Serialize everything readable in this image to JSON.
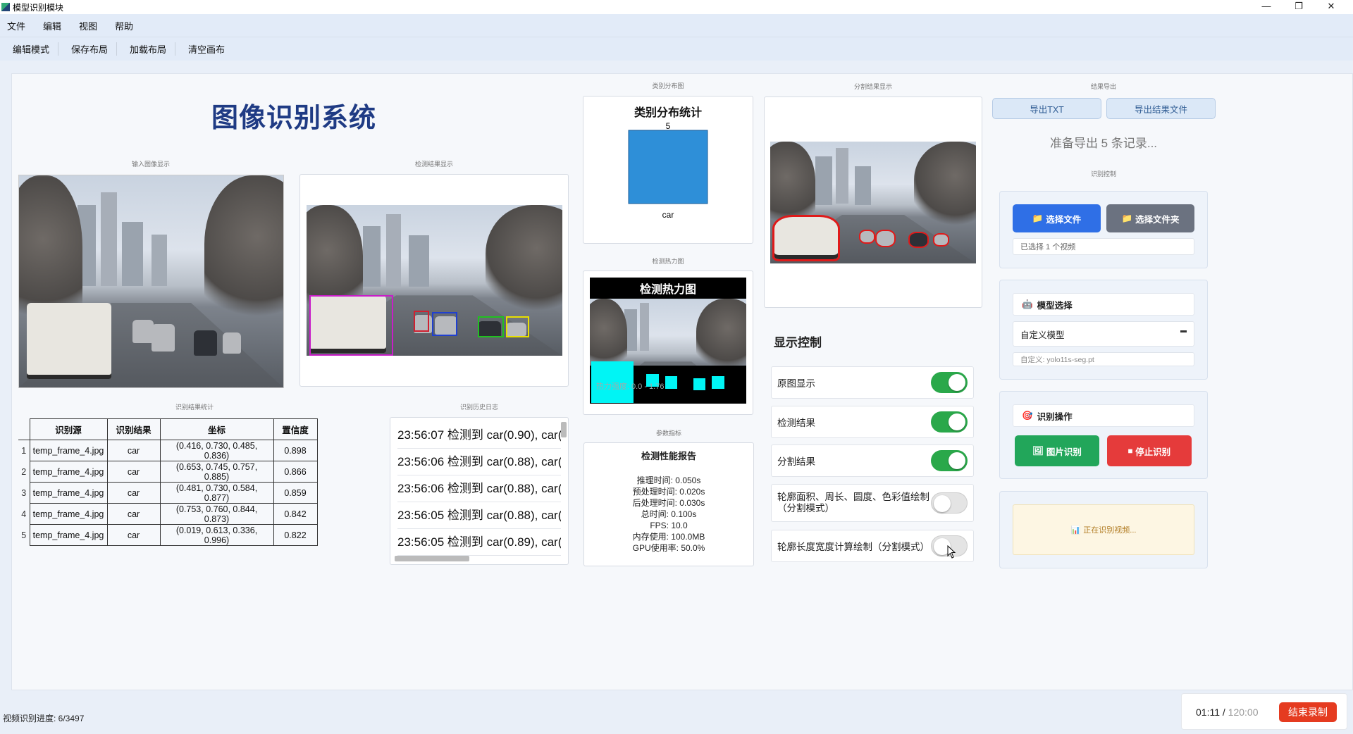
{
  "window": {
    "title": "模型识别模块",
    "controls": [
      "—",
      "❐",
      "✕"
    ]
  },
  "menu": [
    "文件",
    "编辑",
    "视图",
    "帮助"
  ],
  "toolbar": [
    "编辑模式",
    "保存布局",
    "加载布局",
    "清空画布"
  ],
  "main_title": "图像识别系统",
  "captions": {
    "input": "输入图像显示",
    "detect": "检测结果显示",
    "stats": "识别结果统计",
    "history": "识别历史日志",
    "category": "类别分布图",
    "heatmap": "检测热力图",
    "perf": "参数指标",
    "seg": "分割结果显示",
    "export": "结果导出",
    "control": "识别控制"
  },
  "table": {
    "headers": [
      "识别源",
      "识别结果",
      "坐标",
      "置信度"
    ],
    "rows": [
      {
        "idx": "1",
        "src": "temp_frame_4.jpg",
        "cls": "car",
        "coord": "(0.416, 0.730, 0.485, 0.836)",
        "conf": "0.898"
      },
      {
        "idx": "2",
        "src": "temp_frame_4.jpg",
        "cls": "car",
        "coord": "(0.653, 0.745, 0.757, 0.885)",
        "conf": "0.866"
      },
      {
        "idx": "3",
        "src": "temp_frame_4.jpg",
        "cls": "car",
        "coord": "(0.481, 0.730, 0.584, 0.877)",
        "conf": "0.859"
      },
      {
        "idx": "4",
        "src": "temp_frame_4.jpg",
        "cls": "car",
        "coord": "(0.753, 0.760, 0.844, 0.873)",
        "conf": "0.842"
      },
      {
        "idx": "5",
        "src": "temp_frame_4.jpg",
        "cls": "car",
        "coord": "(0.019, 0.613, 0.336, 0.996)",
        "conf": "0.822"
      }
    ]
  },
  "log": [
    "23:56:07 检测到 car(0.90), car(",
    "23:56:06 检测到 car(0.88), car(",
    "23:56:06 检测到 car(0.88), car(",
    "23:56:05 检测到 car(0.88), car(",
    "23:56:05 检测到 car(0.89), car("
  ],
  "chart_data": {
    "type": "bar",
    "title": "类别分布统计",
    "categories": [
      "car"
    ],
    "values": [
      5
    ],
    "colors": [
      "#2e8fd8"
    ]
  },
  "heatmap": {
    "title": "检测热力图",
    "overlay": "热力强度: 0.0 - 1.76"
  },
  "perf": {
    "title": "检测性能报告",
    "lines": [
      "推理时间: 0.050s",
      "预处理时间: 0.020s",
      "后处理时间: 0.030s",
      "总时间: 0.100s",
      "FPS: 10.0",
      "内存使用: 100.0MB",
      "GPU使用率: 50.0%"
    ]
  },
  "display_control": {
    "title": "显示控制",
    "items": [
      {
        "label": "原图显示",
        "on": true
      },
      {
        "label": "检测结果",
        "on": true
      },
      {
        "label": "分割结果",
        "on": true
      },
      {
        "label": "轮廓面积、周长、圆度、色彩值绘制\n（分割模式）",
        "on": false
      },
      {
        "label": "轮廓长度宽度计算绘制（分割模式）",
        "on": false
      }
    ]
  },
  "export": {
    "txt": "导出TXT",
    "file": "导出结果文件",
    "status": "准备导出 5 条记录..."
  },
  "control": {
    "select_file": "选择文件",
    "select_folder": "选择文件夹",
    "selected": "已选择 1 个视频",
    "model_head": "模型选择",
    "model_value": "自定义模型",
    "model_custom": "自定义: yolo11s-seg.pt",
    "op_head": "识别操作",
    "img_btn": "图片识别",
    "stop_btn": "停止识别",
    "status_msg": "正在识别视频..."
  },
  "statusbar": {
    "progress": "视频识别进度: 6/3497"
  },
  "record": {
    "elapsed": "01:11",
    "sep": " / ",
    "total": "120:00",
    "stop_label": "结束录制"
  },
  "colors": {
    "accent": "#2f6fe6",
    "success": "#22a65a",
    "danger": "#e53b3b",
    "title": "#1f3b84",
    "bar": "#2e8fd8"
  }
}
